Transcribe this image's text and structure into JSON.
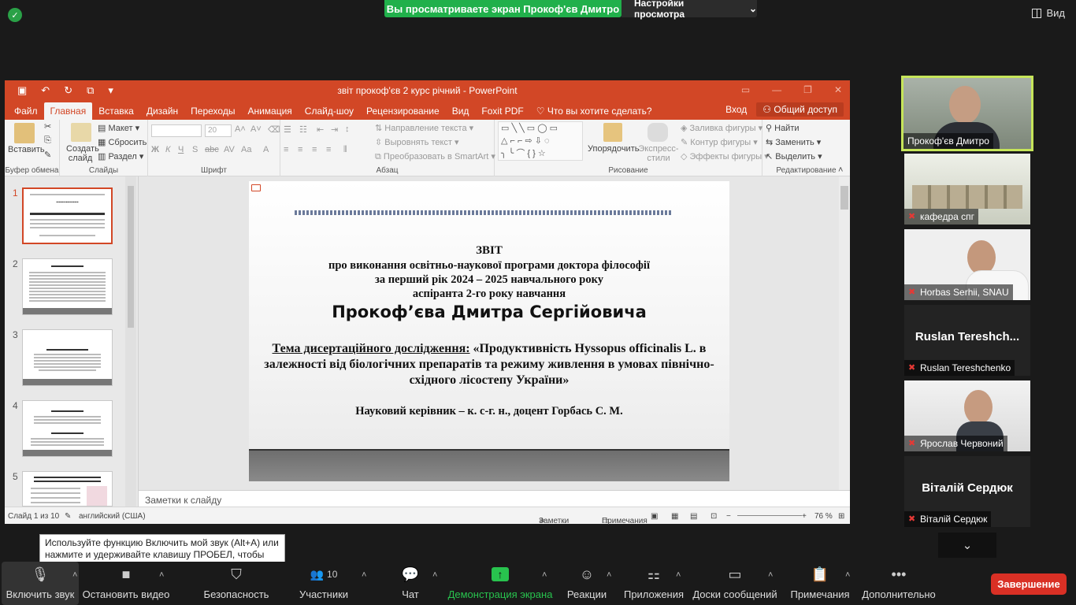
{
  "zoom": {
    "share_banner": "Вы просматриваете экран Прокоф'єв Дмитро",
    "view_settings": "Настройки просмотра",
    "view_button": "Вид",
    "tooltip": "Используйте функцию Включить мой звук (Alt+A) или нажмите и удерживайте клавишу ПРОБЕЛ, чтобы временно включить звук.",
    "end_button": "Завершение",
    "toolbar": {
      "audio": "Включить звук",
      "video": "Остановить видео",
      "security": "Безопасность",
      "participants": "Участники",
      "participants_count": "10",
      "chat": "Чат",
      "share": "Демонстрация экрана",
      "reactions": "Реакции",
      "apps": "Приложения",
      "whiteboards": "Доски сообщений",
      "notes": "Примечания",
      "more": "Дополнительно"
    },
    "participants": [
      {
        "name": "Прокоф'єв Дмитро"
      },
      {
        "name": "кафедра спг"
      },
      {
        "name": "Horbas Serhii, SNAU"
      },
      {
        "name": "Ruslan Tereshchenko",
        "big": "Ruslan  Tereshch..."
      },
      {
        "name": "Ярослав Червоний"
      },
      {
        "name": "Віталій Сердюк",
        "big": "Віталій Сердюк"
      }
    ]
  },
  "ppt": {
    "doc_title": "звіт прокоф'єв 2 курс річний - PowerPoint",
    "tabs": [
      "Файл",
      "Главная",
      "Вставка",
      "Дизайн",
      "Переходы",
      "Анимация",
      "Слайд-шоу",
      "Рецензирование",
      "Вид",
      "Foxit PDF",
      "Что вы хотите сделать?"
    ],
    "login": "Вход",
    "share": "Общий доступ",
    "ribbon": {
      "clipboard": "Буфер обмена",
      "paste": "Вставить",
      "slides": "Слайды",
      "new_slide": "Создать слайд",
      "layout": "Макет",
      "reset": "Сбросить",
      "section": "Раздел",
      "font": "Шрифт",
      "font_size": "20",
      "paragraph": "Абзац",
      "text_direction": "Направление текста",
      "align_text": "Выровнять текст",
      "smartart": "Преобразовать в SmartArt",
      "drawing": "Рисование",
      "arrange": "Упорядочить",
      "quick_styles": "Экспресс-стили",
      "shape_fill": "Заливка фигуры",
      "shape_outline": "Контур фигуры",
      "shape_effects": "Эффекты фигуры",
      "editing": "Редактирование",
      "find": "Найти",
      "replace": "Заменить",
      "select": "Выделить"
    },
    "thumbs": [
      "1",
      "2",
      "3",
      "4",
      "5"
    ],
    "slide": {
      "line1": "ЗВІТ",
      "line2": "про виконання освітньо-наукової програми доктора філософії",
      "line3": "за перший рік 2024 – 2025 навчального року",
      "line4": "аспіранта 2-го року навчання",
      "name": "Прокоф’єва Дмитра Сергійовича",
      "topic_label": "Тема дисертаційного дослідження:",
      "topic_text": " «Продуктивність Hyssopus officinalis L. в залежності від біологічних препаратів та режиму живлення в умовах північно-східного лісостепу України»",
      "supervisor": "Науковий керівник – к. с-г. н., доцент Горбась С. М."
    },
    "notes_placeholder": "Заметки к слайду",
    "status": {
      "slide": "Слайд 1 из 10",
      "language": "английский (США)",
      "notes": "Заметки",
      "comments": "Примечания",
      "zoom": "76 %"
    }
  }
}
